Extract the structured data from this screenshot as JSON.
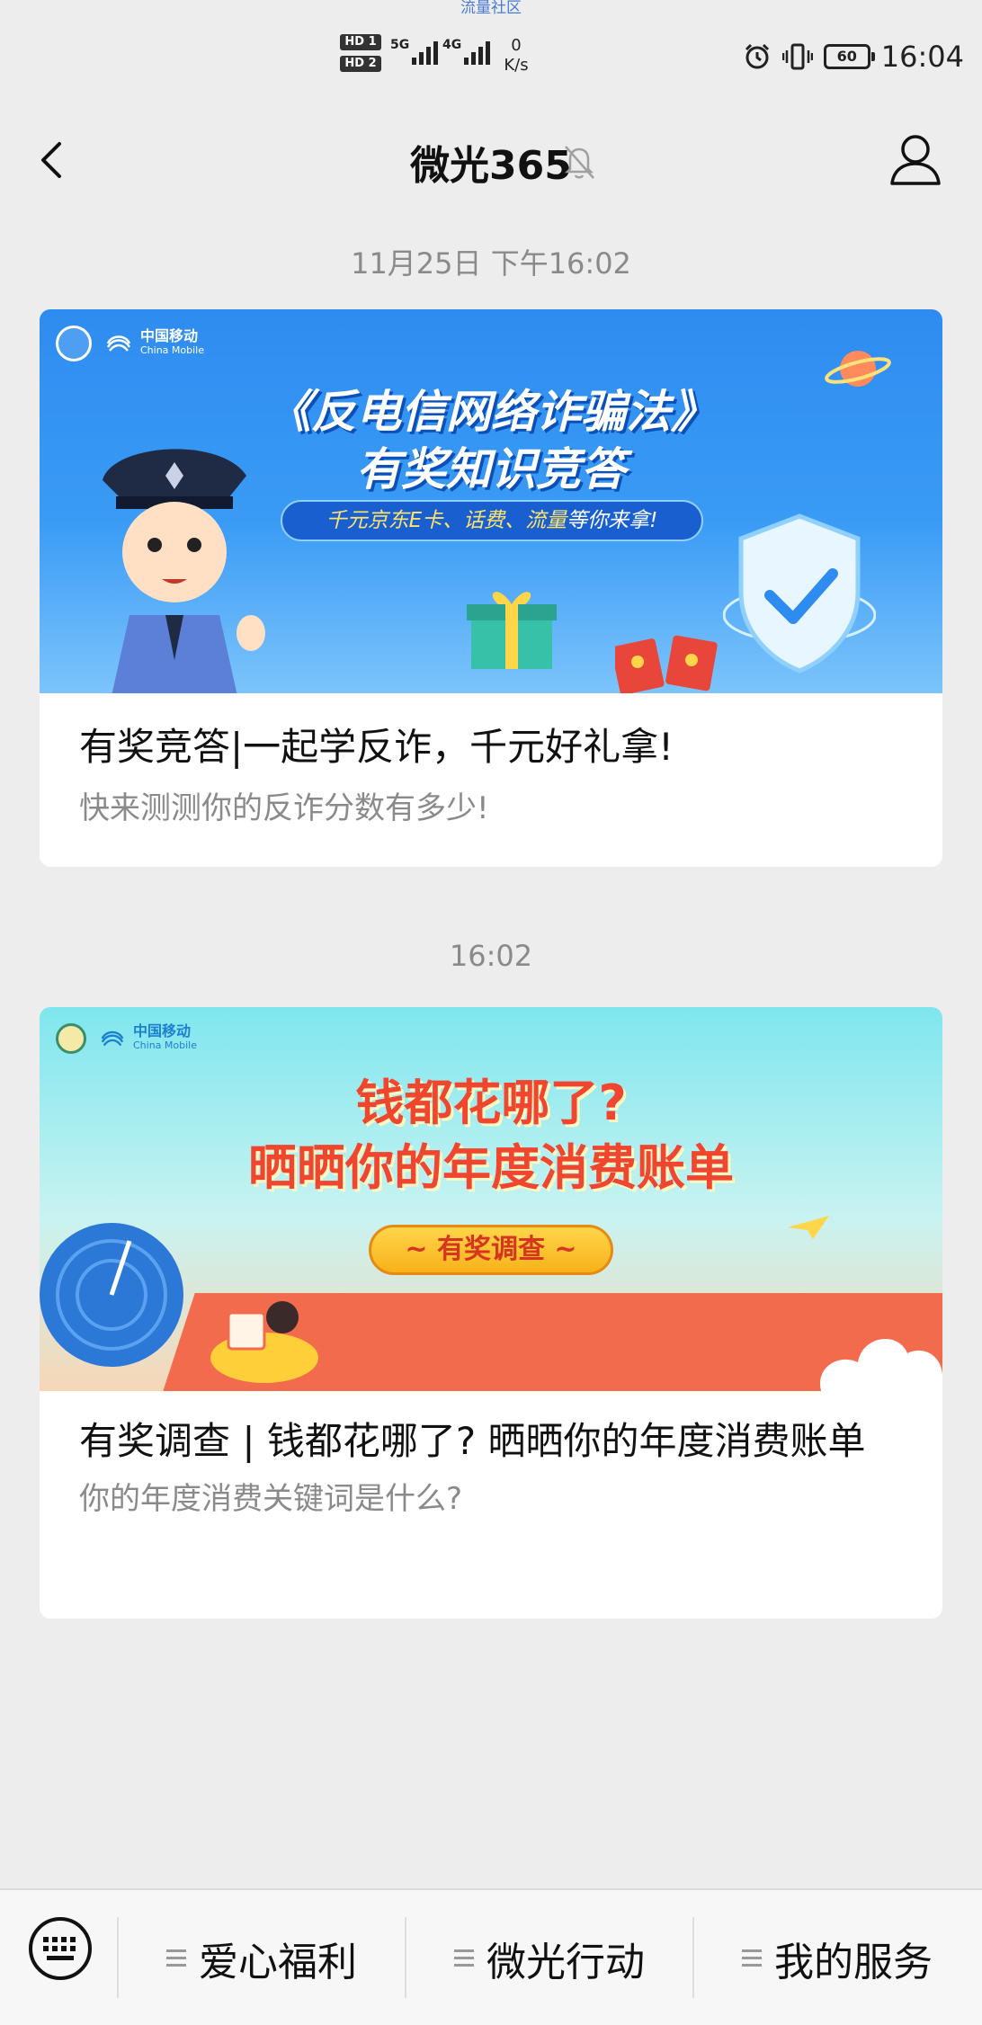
{
  "status_bar": {
    "watermark": "流量社区",
    "sim1": "HD 1",
    "sim2": "HD 2",
    "net1": "5G",
    "net2": "4G",
    "speed_value": "0",
    "speed_unit": "K/s",
    "battery": "60",
    "time": "16:04"
  },
  "nav": {
    "title": "微光365",
    "icons": [
      "back-arrow-icon",
      "mute-bell-icon",
      "profile-icon"
    ]
  },
  "messages": [
    {
      "timestamp": "11月25日 下午16:02",
      "banner": {
        "brand": "中国移动",
        "brand_en": "China Mobile",
        "headline1": "《反电信网络诈骗法》",
        "headline2": "有奖知识竞答",
        "pill_prefix": "千元京东E卡、话费、流量",
        "pill_suffix": "等你来拿!",
        "accent": "#2e8cf0"
      },
      "title": "有奖竞答|一起学反诈，千元好礼拿!",
      "desc": "快来测测你的反诈分数有多少!"
    },
    {
      "timestamp": "16:02",
      "banner": {
        "brand": "中国移动",
        "brand_en": "China Mobile",
        "headline1": "钱都花哪了?",
        "headline2": "晒晒你的年度消费账单",
        "pill": "~ 有奖调查 ~",
        "accent": "#f0452f"
      },
      "title": "有奖调查 | 钱都花哪了? 晒晒你的年度消费账单",
      "desc": "你的年度消费关键词是什么?"
    }
  ],
  "bottom_menu": {
    "keyboard_icon": "keyboard-icon",
    "items": [
      "爱心福利",
      "微光行动",
      "我的服务"
    ]
  },
  "colors": {
    "background": "#ededed",
    "card": "#ffffff",
    "secondary_text": "#8a8a8a"
  }
}
